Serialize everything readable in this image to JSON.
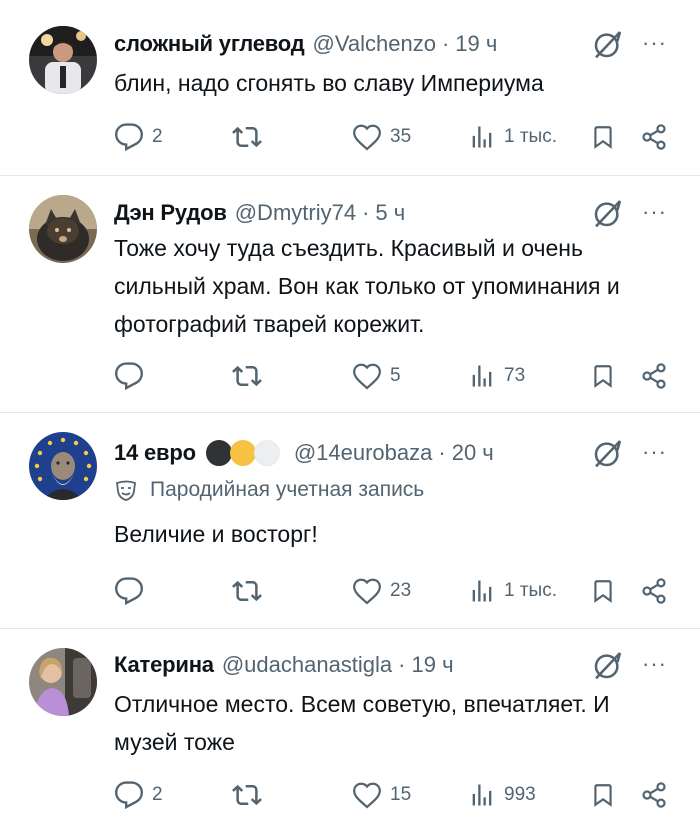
{
  "tweets": [
    {
      "name": "сложный углевод",
      "handle": "@Valchenzo",
      "time": "19 ч",
      "text": "блин, надо сгонять во славу Империума",
      "replies": "2",
      "retweets": "",
      "likes": "35",
      "views": "1 тыс.",
      "more_label": "···"
    },
    {
      "name": "Дэн Рудов",
      "handle": "@Dmytriy74",
      "time": "5 ч",
      "text": "Тоже хочу туда съездить. Красивый и очень сильный храм. Вон как только от упоминания и фотографий тварей корежит.",
      "replies": "",
      "retweets": "",
      "likes": "5",
      "views": "73",
      "more_label": "···"
    },
    {
      "name": "14 евро",
      "handle": "@14eurobaza",
      "time": "20 ч",
      "parody_label": "Пародийная учетная запись",
      "text": "Величие и восторг!",
      "replies": "",
      "retweets": "",
      "likes": "23",
      "views": "1 тыс.",
      "more_label": "···",
      "circle_colors": [
        "#2f3336",
        "#f5c242",
        "#e6e9ec"
      ]
    },
    {
      "name": "Катерина",
      "handle": "@udachanastigla",
      "time": "19 ч",
      "text": "Отличное место. Всем советую, впечатляет. И музей тоже",
      "replies": "2",
      "retweets": "",
      "likes": "15",
      "views": "993",
      "more_label": "···"
    }
  ],
  "separator": "·",
  "colors": {
    "text": "#0f1419",
    "secondary": "#536471",
    "border": "#e6e9ec"
  },
  "icons": [
    "reply-icon",
    "retweet-icon",
    "like-icon",
    "views-icon",
    "bookmark-icon",
    "share-icon",
    "grok-icon",
    "more-icon",
    "parody-mask-icon"
  ]
}
